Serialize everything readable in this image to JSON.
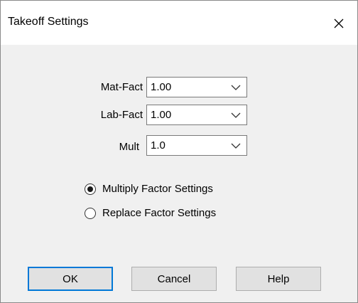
{
  "dialog": {
    "title": "Takeoff Settings",
    "close_icon": "close-icon"
  },
  "fields": {
    "mat_fact": {
      "label": "Mat-Fact",
      "value": "1.00"
    },
    "lab_fact": {
      "label": "Lab-Fact",
      "value": "1.00"
    },
    "mult": {
      "label": "Mult",
      "value": "1.0"
    }
  },
  "options": {
    "multiply": {
      "label": "Multiply Factor Settings",
      "selected": true
    },
    "replace": {
      "label": "Replace Factor Settings",
      "selected": false
    }
  },
  "buttons": {
    "ok": "OK",
    "cancel": "Cancel",
    "help": "Help"
  },
  "colors": {
    "default_button_border": "#0078d7",
    "dialog_background": "#f0f0f0"
  }
}
